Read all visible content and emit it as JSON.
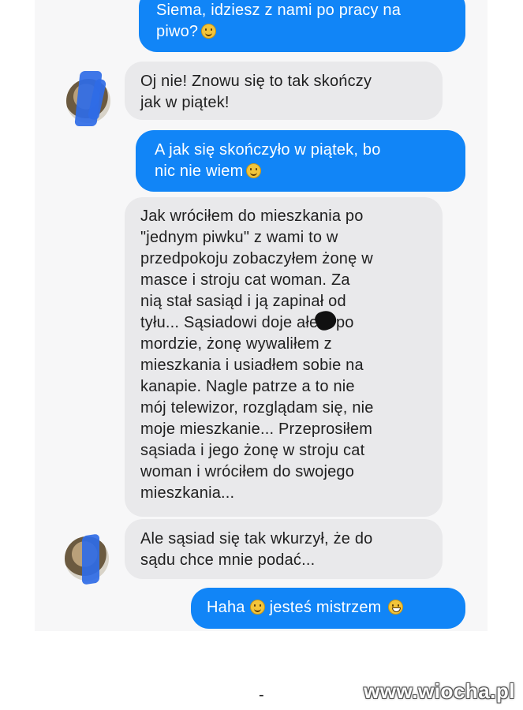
{
  "messages": [
    {
      "lines": [
        "Siema, idziesz z nami po pracy na",
        "piwo?"
      ]
    },
    {
      "lines": [
        "Oj nie! Znowu się to tak skończy",
        "jak w piątek!"
      ]
    },
    {
      "lines": [
        "A jak się skończyło w piątek, bo",
        "nic nie wiem"
      ]
    },
    {
      "lines": [
        "Jak wróciłem do mieszkania po",
        "\"jednym piwku\" z wami to w",
        "przedpokoju zobaczyłem żonę w",
        "masce i stroju cat woman. Za",
        "nią stał sasiąd i ją zapinał od",
        "tyłu... Sąsiadowi doje  ałem po",
        "mordzie, żonę wywaliłem z",
        "mieszkania i usiadłem sobie na",
        "kanapie. Nagle patrze a to nie",
        "mój telewizor, rozglądam się, nie",
        "moje mieszkanie... Przeprosiłem",
        "sąsiada i jego żonę w stroju cat",
        "woman i wróciłem do swojego",
        "mieszkania..."
      ]
    },
    {
      "lines": [
        "Ale sąsiad się tak wkurzył, że do",
        "sądu chce mnie podać..."
      ]
    },
    {
      "lines": [
        "Haha",
        "jesteś mistrzem"
      ]
    }
  ],
  "emojis": {
    "smile": "smile-emoji",
    "grin": "grin-emoji",
    "laugh": "laughing-emoji"
  },
  "footer": {
    "dash": "-",
    "watermark": "www.wiocha.pl"
  },
  "colors": {
    "outgoing": "#1185f7",
    "incoming": "#e9e9eb",
    "avatar_scribble": "#2f6be6"
  }
}
